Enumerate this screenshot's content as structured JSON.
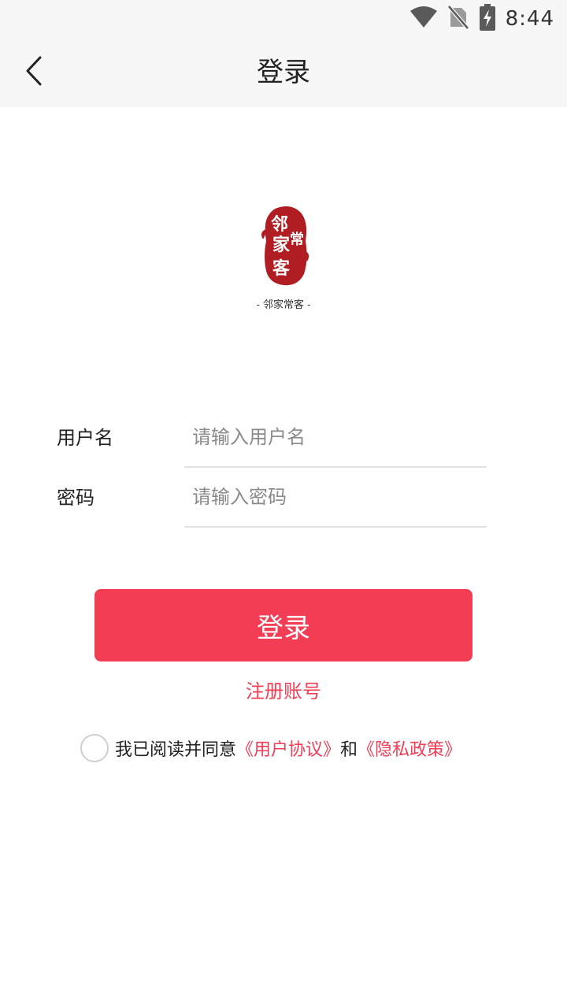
{
  "status_bar": {
    "time": "8:44",
    "icons": [
      "wifi-icon",
      "no-sim-icon",
      "battery-charging-icon"
    ]
  },
  "nav": {
    "title": "登录",
    "back_icon": "chevron-left-icon"
  },
  "logo": {
    "caption": "- 邻家常客 -",
    "seal_colors": {
      "seal": "#b01e23",
      "text": "#ffffff"
    }
  },
  "form": {
    "username": {
      "label": "用户名",
      "placeholder": "请输入用户名",
      "value": ""
    },
    "password": {
      "label": "密码",
      "placeholder": "请输入密码",
      "value": ""
    }
  },
  "actions": {
    "login_label": "登录",
    "register_label": "注册账号"
  },
  "agreement": {
    "prefix": "我已阅读并同意",
    "user_agreement": "《用户协议》",
    "conjunction": "和",
    "privacy_policy": "《隐私政策》",
    "checked": false
  },
  "colors": {
    "accent": "#f33d55",
    "header_bg": "#f7f7f7",
    "divider": "#e2e2e2"
  }
}
